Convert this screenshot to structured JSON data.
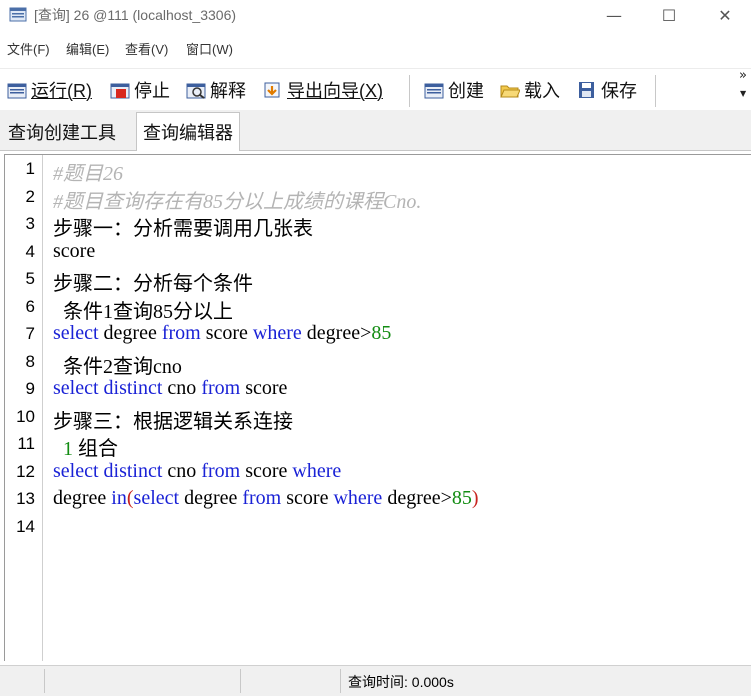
{
  "window": {
    "title": "[查询] 26 @111 (localhost_3306)",
    "controls": {
      "minimize": "—",
      "maximize": "☐",
      "close": "✕"
    }
  },
  "menu": {
    "items": [
      "文件(F)",
      "编辑(E)",
      "查看(V)",
      "窗口(W)"
    ]
  },
  "toolbar": {
    "run": "运行(R)",
    "stop": "停止",
    "explain": "解释",
    "export_wizard": "导出向导(X)",
    "create": "创建",
    "load": "载入",
    "save": "保存",
    "overflow": "»"
  },
  "tabs": [
    {
      "label": "查询创建工具",
      "active": false
    },
    {
      "label": "查询编辑器",
      "active": true
    }
  ],
  "editor": {
    "line_numbers": [
      "1",
      "2",
      "3",
      "4",
      "5",
      "6",
      "7",
      "8",
      "9",
      "10",
      "11",
      "12",
      "13",
      "14"
    ],
    "lines": [
      [
        {
          "t": "#题目26",
          "c": "cmt"
        }
      ],
      [
        {
          "t": "#题目查询存在有85分以上成绩的课程Cno.",
          "c": "cmt"
        }
      ],
      [
        {
          "t": "步骤一：分析需要调用几张表",
          "c": ""
        }
      ],
      [
        {
          "t": "score",
          "c": ""
        }
      ],
      [
        {
          "t": "步骤二：分析每个条件",
          "c": ""
        }
      ],
      [
        {
          "t": "  条件1查询85分以上",
          "c": ""
        }
      ],
      [
        {
          "t": "select",
          "c": "kw"
        },
        {
          "t": " degree ",
          "c": ""
        },
        {
          "t": "from",
          "c": "kw"
        },
        {
          "t": " score ",
          "c": ""
        },
        {
          "t": "where",
          "c": "kw"
        },
        {
          "t": " degree>",
          "c": ""
        },
        {
          "t": "85",
          "c": "num"
        }
      ],
      [
        {
          "t": "  条件2查询cno",
          "c": ""
        }
      ],
      [
        {
          "t": "select",
          "c": "kw"
        },
        {
          "t": " ",
          "c": ""
        },
        {
          "t": "distinct",
          "c": "kw"
        },
        {
          "t": " cno ",
          "c": ""
        },
        {
          "t": "from",
          "c": "kw"
        },
        {
          "t": " score",
          "c": ""
        }
      ],
      [
        {
          "t": "步骤三：根据逻辑关系连接",
          "c": ""
        }
      ],
      [
        {
          "t": "  ",
          "c": ""
        },
        {
          "t": "1",
          "c": "num"
        },
        {
          "t": " 组合",
          "c": ""
        }
      ],
      [
        {
          "t": "select",
          "c": "kw"
        },
        {
          "t": " ",
          "c": ""
        },
        {
          "t": "distinct",
          "c": "kw"
        },
        {
          "t": " cno ",
          "c": ""
        },
        {
          "t": "from",
          "c": "kw"
        },
        {
          "t": " score ",
          "c": ""
        },
        {
          "t": "where",
          "c": "kw"
        }
      ],
      [
        {
          "t": "degree ",
          "c": ""
        },
        {
          "t": "in",
          "c": "kw"
        },
        {
          "t": "(",
          "c": "par"
        },
        {
          "t": "select",
          "c": "kw"
        },
        {
          "t": " degree ",
          "c": ""
        },
        {
          "t": "from",
          "c": "kw"
        },
        {
          "t": " score ",
          "c": ""
        },
        {
          "t": "where",
          "c": "kw"
        },
        {
          "t": " degree>",
          "c": ""
        },
        {
          "t": "85",
          "c": "num"
        },
        {
          "t": ")",
          "c": "par"
        }
      ],
      []
    ]
  },
  "status": {
    "query_time": "查询时间: 0.000s"
  },
  "colors": {
    "keyword": "#1a22d6",
    "number": "#128c12",
    "comment": "#b4b4b4",
    "paren": "#c8221e"
  },
  "icons": [
    "navicat-app-icon",
    "run-icon",
    "stop-icon",
    "explain-icon",
    "export-icon",
    "create-icon",
    "load-folder-icon",
    "save-disk-icon"
  ]
}
